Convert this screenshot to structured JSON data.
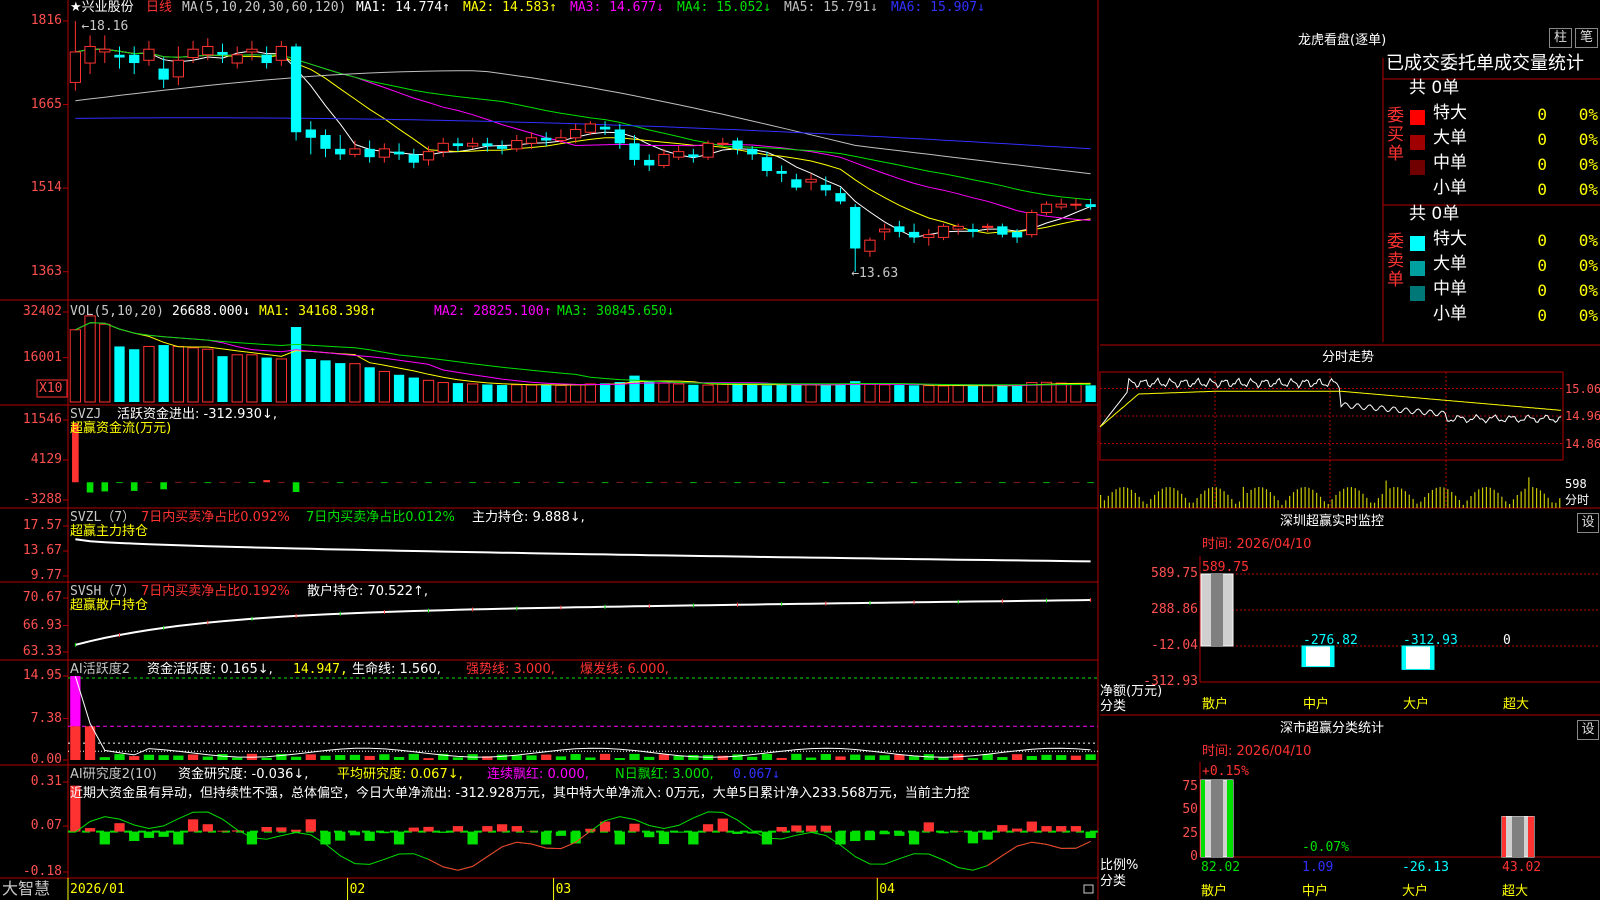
{
  "colors": {
    "up": "#ff3232",
    "down": "#00ffff",
    "frame": "#b40000",
    "yellow": "#ffff00",
    "magenta": "#ff00ff",
    "green": "#00e000",
    "white": "#ffffff",
    "blue": "#3030ff",
    "gray": "#b0b0b0"
  },
  "main": {
    "stock_name": "★兴业股份",
    "period": "日线",
    "ma_title": "MA(5,10,20,30,60,120)",
    "ma_items": [
      {
        "label": "MA1: 14.774↑",
        "color": "#ffffff"
      },
      {
        "label": "MA2: 14.583↑",
        "color": "#ffff00"
      },
      {
        "label": "MA3: 14.677↓",
        "color": "#ff00ff"
      },
      {
        "label": "MA4: 15.052↓",
        "color": "#00e000"
      },
      {
        "label": "MA5: 15.791↓",
        "color": "#c0c0c0"
      },
      {
        "label": "MA6: 15.907↓",
        "color": "#3030ff"
      }
    ],
    "y_ticks": [
      "1816",
      "1665",
      "1514",
      "1363"
    ],
    "high_label": "←18.16",
    "low_label": "←13.63",
    "candles": [
      [
        17.05,
        17.6,
        18.16,
        16.9
      ],
      [
        17.4,
        17.7,
        17.9,
        17.2
      ],
      [
        17.6,
        17.65,
        17.9,
        17.4
      ],
      [
        17.55,
        17.5,
        17.7,
        17.3
      ],
      [
        17.55,
        17.4,
        17.7,
        17.2
      ],
      [
        17.45,
        17.65,
        17.8,
        17.35
      ],
      [
        17.3,
        17.1,
        17.5,
        16.95
      ],
      [
        17.15,
        17.45,
        17.7,
        17.0
      ],
      [
        17.5,
        17.65,
        17.8,
        17.4
      ],
      [
        17.55,
        17.7,
        17.85,
        17.45
      ],
      [
        17.6,
        17.55,
        17.75,
        17.4
      ],
      [
        17.4,
        17.55,
        17.7,
        17.3
      ],
      [
        17.6,
        17.65,
        17.8,
        17.45
      ],
      [
        17.55,
        17.4,
        17.7,
        17.3
      ],
      [
        17.45,
        17.7,
        17.8,
        17.35
      ],
      [
        17.7,
        16.15,
        17.75,
        16.0
      ],
      [
        16.2,
        16.05,
        16.35,
        15.75
      ],
      [
        16.1,
        15.85,
        16.2,
        15.7
      ],
      [
        15.85,
        15.75,
        16.1,
        15.65
      ],
      [
        15.75,
        15.85,
        16.0,
        15.7
      ],
      [
        15.85,
        15.7,
        16.0,
        15.6
      ],
      [
        15.7,
        15.85,
        15.95,
        15.6
      ],
      [
        15.8,
        15.75,
        15.95,
        15.65
      ],
      [
        15.75,
        15.6,
        15.85,
        15.5
      ],
      [
        15.65,
        15.8,
        15.9,
        15.55
      ],
      [
        15.8,
        15.95,
        16.05,
        15.7
      ],
      [
        15.95,
        15.9,
        16.05,
        15.8
      ],
      [
        15.9,
        15.95,
        16.05,
        15.85
      ],
      [
        15.95,
        15.9,
        16.05,
        15.8
      ],
      [
        15.9,
        15.85,
        16.0,
        15.75
      ],
      [
        15.85,
        16.0,
        16.1,
        15.8
      ],
      [
        15.95,
        16.05,
        16.15,
        15.85
      ],
      [
        16.05,
        16.0,
        16.15,
        15.9
      ],
      [
        16.0,
        16.05,
        16.2,
        15.95
      ],
      [
        16.05,
        16.2,
        16.3,
        15.95
      ],
      [
        16.15,
        16.3,
        16.35,
        16.1
      ],
      [
        16.25,
        16.2,
        16.35,
        16.1
      ],
      [
        16.2,
        15.95,
        16.3,
        15.85
      ],
      [
        15.95,
        15.65,
        16.1,
        15.55
      ],
      [
        15.65,
        15.55,
        15.75,
        15.45
      ],
      [
        15.55,
        15.75,
        15.85,
        15.5
      ],
      [
        15.7,
        15.8,
        15.9,
        15.65
      ],
      [
        15.75,
        15.7,
        15.85,
        15.6
      ],
      [
        15.7,
        15.95,
        16.0,
        15.65
      ],
      [
        15.95,
        15.95,
        16.05,
        15.9
      ],
      [
        16.0,
        15.85,
        16.05,
        15.75
      ],
      [
        15.85,
        15.75,
        15.9,
        15.65
      ],
      [
        15.7,
        15.45,
        15.8,
        15.35
      ],
      [
        15.45,
        15.4,
        15.55,
        15.25
      ],
      [
        15.3,
        15.15,
        15.4,
        15.1
      ],
      [
        15.25,
        15.3,
        15.4,
        15.1
      ],
      [
        15.2,
        15.1,
        15.35,
        15.0
      ],
      [
        15.05,
        14.9,
        15.15,
        14.85
      ],
      [
        14.8,
        14.05,
        14.85,
        13.63
      ],
      [
        14.0,
        14.2,
        14.25,
        13.9
      ],
      [
        14.35,
        14.4,
        14.5,
        14.2
      ],
      [
        14.45,
        14.35,
        14.55,
        14.25
      ],
      [
        14.35,
        14.25,
        14.5,
        14.15
      ],
      [
        14.25,
        14.3,
        14.4,
        14.1
      ],
      [
        14.25,
        14.45,
        14.5,
        14.2
      ],
      [
        14.4,
        14.45,
        14.5,
        14.3
      ],
      [
        14.4,
        14.35,
        14.5,
        14.25
      ],
      [
        14.45,
        14.45,
        14.5,
        14.35
      ],
      [
        14.45,
        14.3,
        14.5,
        14.25
      ],
      [
        14.35,
        14.25,
        14.4,
        14.15
      ],
      [
        14.3,
        14.7,
        14.75,
        14.25
      ],
      [
        14.7,
        14.85,
        14.9,
        14.65
      ],
      [
        14.8,
        14.85,
        14.95,
        14.75
      ],
      [
        14.85,
        14.85,
        14.95,
        14.75
      ],
      [
        14.85,
        14.8,
        14.95,
        14.75
      ]
    ]
  },
  "vol": {
    "title": "VOL(5,10,20)",
    "value": "26688.000↓",
    "ma_items": [
      {
        "label": "MA1: 34168.398↑",
        "color": "#ffff00"
      },
      {
        "label": "MA2: 28825.100↑",
        "color": "#ff00ff"
      },
      {
        "label": "MA3: 30845.650↓",
        "color": "#00e000"
      }
    ],
    "y_ticks": [
      "32402",
      "16001"
    ],
    "unit": "X10",
    "values": [
      26000,
      31000,
      28000,
      20000,
      19000,
      20000,
      20500,
      20000,
      19500,
      19000,
      16500,
      17000,
      17000,
      16000,
      15500,
      27000,
      15500,
      15000,
      14000,
      13800,
      12500,
      11000,
      9800,
      8800,
      7800,
      7000,
      6800,
      6500,
      6300,
      6100,
      6200,
      6100,
      6200,
      6000,
      6300,
      6500,
      6700,
      7200,
      9500,
      7600,
      6800,
      6500,
      6200,
      6100,
      6500,
      6300,
      6400,
      6000,
      6200,
      6100,
      6300,
      6200,
      6500,
      7500,
      6400,
      6200,
      6100,
      6000,
      5900,
      5800,
      5900,
      6000,
      5900,
      5800,
      6000,
      7000,
      7100,
      6800,
      6500,
      6000
    ]
  },
  "svzj": {
    "title": "SVZJ",
    "desc": "活跃资金进出: -312.930↓,",
    "sub": "超赢资金流(万元)",
    "y_ticks": [
      "11546",
      "4129",
      "-3288"
    ]
  },
  "svzl": {
    "title": "SVZL（7）",
    "item1": "7日内买卖净占比0.092%",
    "item2": "7日内买卖净占比0.012%",
    "item3": "主力持仓: 9.888↓,",
    "sub": "超赢主力持仓",
    "y_ticks": [
      "17.57",
      "13.67",
      "9.77"
    ]
  },
  "svsh": {
    "title": "SVSH（7）",
    "item1": "7日内买卖净占比0.192%",
    "item2": "散户持仓: 70.522↑,",
    "sub": "超赢散户持仓",
    "y_ticks": [
      "70.67",
      "66.93",
      "63.33"
    ]
  },
  "aihy": {
    "title": "AI活跃度2",
    "item1": "资金活跃度: 0.165↓,",
    "item2": "14.947,",
    "item3": "生命线: 1.560,",
    "item4": "强势线: 3.000,",
    "item5": "爆发线: 6.000,",
    "y_ticks": [
      "14.95",
      "7.38",
      "0.00"
    ]
  },
  "aiyj": {
    "title": "AI研究度2(10)",
    "item1": "资金研究度: -0.036↓,",
    "item2": "平均研究度: 0.067↓,",
    "item3": "连续飘红: 0.000,",
    "item4": "N日飘红: 3.000,",
    "item5": "0.067↓",
    "commentary": "近期大资金虽有异动，但持续性不强，总体偏空，今日大单净流出: -312.928万元，其中特大单净流入: 0万元，大单5日累计净入233.568万元，当前主力控",
    "y_ticks": [
      "0.31",
      "0.07",
      "-0.18"
    ]
  },
  "xaxis": {
    "brand": "大智慧",
    "labels": [
      {
        "text": "2026/01",
        "i": 0
      },
      {
        "text": "02",
        "i": 19
      },
      {
        "text": "03",
        "i": 33
      },
      {
        "text": "04",
        "i": 55
      }
    ]
  },
  "right": {
    "lhb": {
      "title": "龙虎看盘(逐单)",
      "btn1": "柱",
      "btn2": "笔",
      "header": "已成交委托单成交量统计",
      "buy": {
        "label": "委买单",
        "count": "共 0单",
        "rows": [
          {
            "name": "特大",
            "n": "0",
            "pct": "0%",
            "color": "#ff0000"
          },
          {
            "name": "大单",
            "n": "0",
            "pct": "0%",
            "color": "#a00000"
          },
          {
            "name": "中单",
            "n": "0",
            "pct": "0%",
            "color": "#700000"
          },
          {
            "name": "小单",
            "n": "0",
            "pct": "0%",
            "color": "#000000"
          }
        ]
      },
      "sell": {
        "label": "委卖单",
        "count": "共 0单",
        "rows": [
          {
            "name": "特大",
            "n": "0",
            "pct": "0%",
            "color": "#00ffff"
          },
          {
            "name": "大单",
            "n": "0",
            "pct": "0%",
            "color": "#00a0a0"
          },
          {
            "name": "中单",
            "n": "0",
            "pct": "0%",
            "color": "#007878"
          },
          {
            "name": "小单",
            "n": "0",
            "pct": "0%",
            "color": "#000000"
          }
        ]
      }
    },
    "fenshi": {
      "title": "分时走势",
      "price_ticks": [
        "15.06",
        "14.96",
        "14.86"
      ],
      "vol_label": "598",
      "vol_unit": "分时"
    },
    "szjk": {
      "title": "深圳超赢实时监控",
      "btn": "设",
      "time": "时间: 2026/04/10",
      "y_ticks": [
        "589.75",
        "288.86",
        "-12.04",
        "-312.93"
      ],
      "ylabel": "净额(万元)",
      "xlabel": "分类",
      "bars": [
        {
          "name": "散户",
          "value": 589.75,
          "label": "589.75"
        },
        {
          "name": "中户",
          "value": -276.82,
          "label": "-276.82"
        },
        {
          "name": "大户",
          "value": -312.93,
          "label": "-312.93"
        },
        {
          "name": "超大",
          "value": 0,
          "label": "0"
        }
      ]
    },
    "ssfl": {
      "title": "深市超赢分类统计",
      "btn": "设",
      "time": "时间: 2026/04/10",
      "y_ticks": [
        "75",
        "50",
        "25",
        "0"
      ],
      "ylabel": "比例%",
      "xlabel": "分类",
      "top_labels": [
        "+0.15%",
        "-0.07%"
      ],
      "bars": [
        {
          "name": "散户",
          "value": 82.02,
          "label": "82.02",
          "color": "#00e000"
        },
        {
          "name": "中户",
          "value": 1.09,
          "label": "1.09",
          "color": "#3030ff"
        },
        {
          "name": "大户",
          "value": -26.13,
          "label": "-26.13",
          "color": "#00ffff"
        },
        {
          "name": "超大",
          "value": 43.02,
          "label": "43.02",
          "color": "#ff3232"
        }
      ]
    }
  },
  "chart_data": [
    {
      "type": "candlestick",
      "title": "兴业股份 日线",
      "ylim": [
        13.3,
        18.25
      ],
      "x_labels": [
        "2026/01",
        "02",
        "03",
        "04"
      ],
      "series_note": "OHLC in main.candles"
    },
    {
      "type": "bar",
      "title": "VOL(5,10,20)",
      "ylim": [
        0,
        32402
      ]
    },
    {
      "type": "bar",
      "title": "深圳超赢实时监控",
      "categories": [
        "散户",
        "中户",
        "大户",
        "超大"
      ],
      "values": [
        589.75,
        -276.82,
        -312.93,
        0
      ],
      "ylim": [
        -312.93,
        589.75
      ]
    },
    {
      "type": "bar",
      "title": "深市超赢分类统计",
      "categories": [
        "散户",
        "中户",
        "大户",
        "超大"
      ],
      "values": [
        82.02,
        1.09,
        -26.13,
        43.02
      ]
    }
  ]
}
